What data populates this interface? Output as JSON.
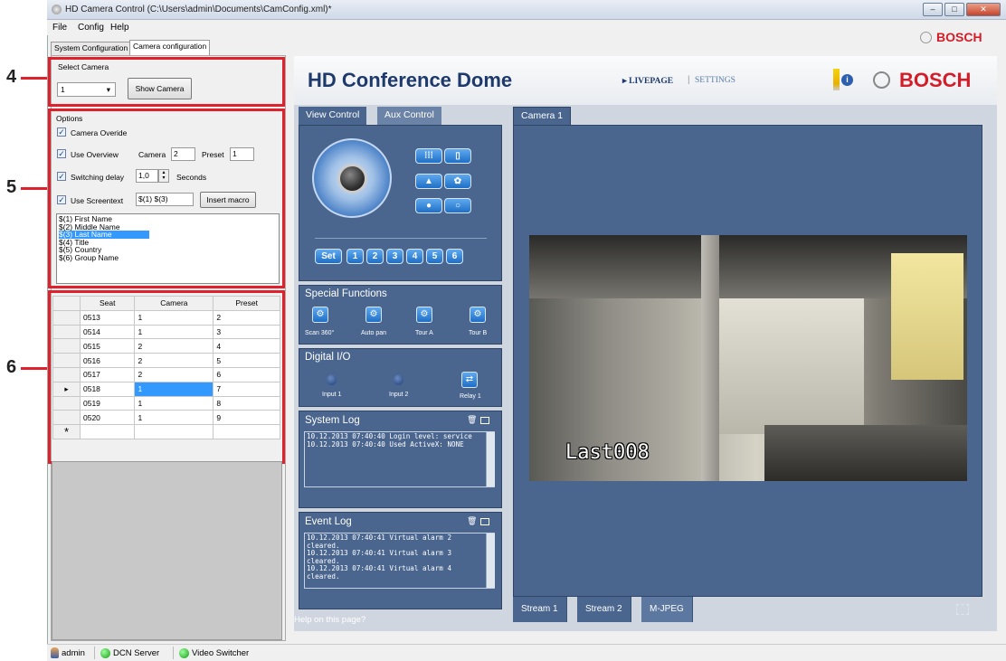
{
  "window": {
    "title": "HD Camera Control (C:\\Users\\admin\\Documents\\CamConfig.xml)*",
    "controls": [
      "–",
      "□",
      "✕"
    ]
  },
  "menu": [
    "File",
    "Config",
    "Help"
  ],
  "brand": "BOSCH",
  "tabs": [
    "System Configuration",
    "Camera configuration"
  ],
  "callouts": [
    "4",
    "5",
    "6"
  ],
  "select_camera": {
    "group": "Select Camera",
    "value": "1",
    "button": "Show Camera"
  },
  "options": {
    "group": "Options",
    "camera_override": "Camera Overide",
    "use_overview": "Use Overview",
    "camera_label": "Camera",
    "camera_value": "2",
    "preset_label": "Preset",
    "preset_value": "1",
    "switching_delay": "Switching delay",
    "delay_value": "1,0",
    "seconds": "Seconds",
    "use_screentext": "Use Screentext",
    "screentext_value": "$(1) $(3)",
    "insert_macro": "Insert macro",
    "macros": [
      "$(1) First Name",
      "$(2) Middle Name",
      "$(3) Last Name",
      "$(4) Title",
      "$(5) Country",
      "$(6) Group Name"
    ],
    "selected_macro": 2
  },
  "seat_table": {
    "headers": [
      "Seat",
      "Camera",
      "Preset"
    ],
    "rows": [
      [
        "0513",
        "1",
        "2"
      ],
      [
        "0514",
        "1",
        "3"
      ],
      [
        "0515",
        "2",
        "4"
      ],
      [
        "0516",
        "2",
        "5"
      ],
      [
        "0517",
        "2",
        "6"
      ],
      [
        "0518",
        "1",
        "7"
      ],
      [
        "0519",
        "1",
        "8"
      ],
      [
        "0520",
        "1",
        "9"
      ]
    ],
    "current_row_marker": "▸",
    "new_row_marker": "*"
  },
  "web": {
    "title": "HD Conference Dome",
    "nav_live": "▸ LIVEPAGE",
    "nav_sep": "|",
    "nav_settings": "SETTINGS",
    "view_tab": "View Control",
    "aux_tab": "Aux Control",
    "preset_set": "Set",
    "presets": [
      "1",
      "2",
      "3",
      "4",
      "5",
      "6"
    ],
    "special_functions": "Special Functions",
    "sf_labels": [
      "Scan 360°",
      "Auto pan",
      "Tour A",
      "Tour B"
    ],
    "digital_io": "Digital I/O",
    "io_labels": [
      "Input 1",
      "Input 2",
      "Relay 1"
    ],
    "system_log": "System Log",
    "system_log_lines": [
      "10.12.2013 07:40:40 Login level: service",
      "10.12.2013 07:40:40 Used ActiveX: NONE"
    ],
    "event_log": "Event Log",
    "event_log_lines": [
      "10.12.2013 07:40:41 Virtual alarm 2",
      "cleared.",
      "10.12.2013 07:40:41 Virtual alarm 3",
      "cleared.",
      "10.12.2013 07:40:41 Virtual alarm 4",
      "cleared."
    ],
    "help": "Help on this page?",
    "camera_tab": "Camera 1",
    "overlay_text": "Last008",
    "streams": [
      "Stream 1",
      "Stream 2",
      "M-JPEG"
    ]
  },
  "status": {
    "user": "admin",
    "dcn": "DCN Server",
    "switcher": "Video Switcher"
  },
  "colors": {
    "bosch_red": "#d41c28",
    "web_blue": "#4a668f",
    "accent_blue": "#3399ff",
    "callout_red": "#e0202b"
  }
}
